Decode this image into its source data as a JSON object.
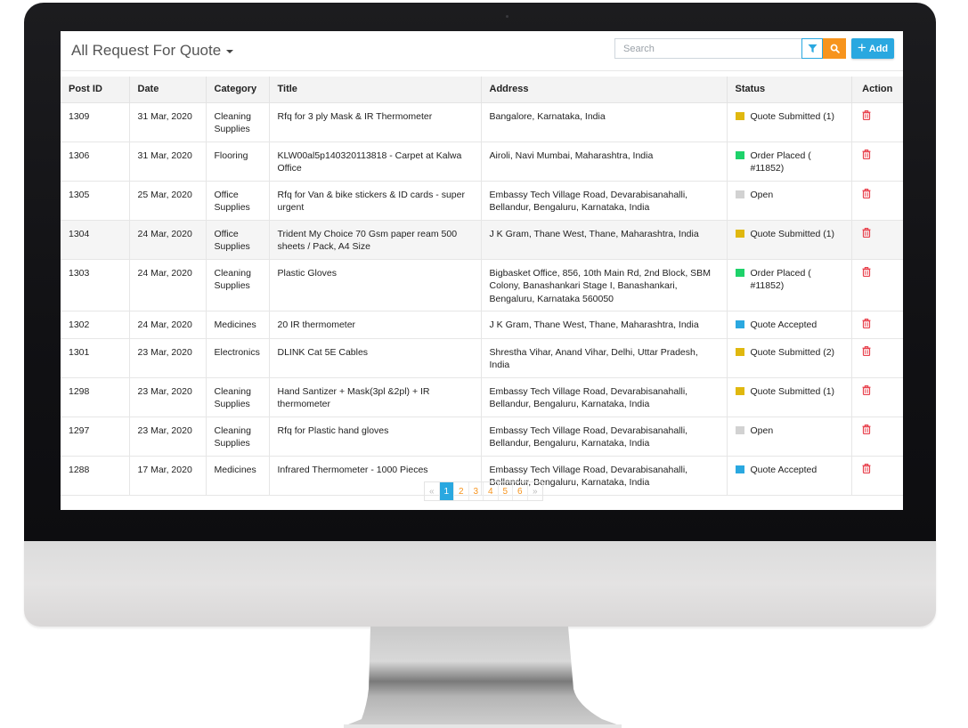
{
  "header": {
    "title": "All Request For Quote",
    "search_placeholder": "Search",
    "add_label": "Add"
  },
  "table": {
    "columns": [
      "Post ID",
      "Date",
      "Category",
      "Title",
      "Address",
      "Status",
      "Action"
    ],
    "rows": [
      {
        "id": "1309",
        "date": "31 Mar, 2020",
        "category": "Cleaning Supplies",
        "title": "Rfq for 3 ply Mask & IR Thermometer",
        "address": "Bangalore, Karnataka, India",
        "status": "Quote Submitted (1)",
        "status_color": "#e0b80f"
      },
      {
        "id": "1306",
        "date": "31 Mar, 2020",
        "category": "Flooring",
        "title": "KLW00al5p140320113818 - Carpet at Kalwa Office",
        "address": "Airoli, Navi Mumbai, Maharashtra, India",
        "status": "Order Placed ( #11852)",
        "status_color": "#1ed26a"
      },
      {
        "id": "1305",
        "date": "25 Mar, 2020",
        "category": "Office Supplies",
        "title": "Rfq for Van & bike stickers & ID cards - super urgent",
        "address": "Embassy Tech Village Road, Devarabisanahalli, Bellandur, Bengaluru, Karnataka, India",
        "status": "Open",
        "status_color": "#d2d2d2"
      },
      {
        "id": "1304",
        "date": "24 Mar, 2020",
        "category": "Office Supplies",
        "title": "Trident My Choice 70 Gsm paper ream 500 sheets / Pack, A4 Size",
        "address": "J K Gram, Thane West, Thane, Maharashtra, India",
        "status": "Quote Submitted (1)",
        "status_color": "#e0b80f"
      },
      {
        "id": "1303",
        "date": "24 Mar, 2020",
        "category": "Cleaning Supplies",
        "title": "Plastic Gloves",
        "address": "Bigbasket Office, 856, 10th Main Rd, 2nd Block, SBM Colony, Banashankari Stage I, Banashankari, Bengaluru, Karnataka 560050",
        "status": "Order Placed ( #11852)",
        "status_color": "#1ed26a"
      },
      {
        "id": "1302",
        "date": "24 Mar, 2020",
        "category": "Medicines",
        "title": "20 IR thermometer",
        "address": "J K Gram, Thane West, Thane, Maharashtra, India",
        "status": "Quote Accepted",
        "status_color": "#2aa8e0"
      },
      {
        "id": "1301",
        "date": "23 Mar, 2020",
        "category": "Electronics",
        "title": "DLINK Cat 5E Cables",
        "address": "Shrestha Vihar, Anand Vihar, Delhi, Uttar Pradesh, India",
        "status": "Quote Submitted (2)",
        "status_color": "#e0b80f"
      },
      {
        "id": "1298",
        "date": "23 Mar, 2020",
        "category": "Cleaning Supplies",
        "title": "Hand Santizer + Mask(3pl &2pl) + IR thermometer",
        "address": "Embassy Tech Village Road, Devarabisanahalli, Bellandur, Bengaluru, Karnataka, India",
        "status": "Quote Submitted (1)",
        "status_color": "#e0b80f"
      },
      {
        "id": "1297",
        "date": "23 Mar, 2020",
        "category": "Cleaning Supplies",
        "title": "Rfq for Plastic hand gloves",
        "address": "Embassy Tech Village Road, Devarabisanahalli, Bellandur, Bengaluru, Karnataka, India",
        "status": "Open",
        "status_color": "#d2d2d2"
      },
      {
        "id": "1288",
        "date": "17 Mar, 2020",
        "category": "Medicines",
        "title": "Infrared Thermometer - 1000 Pieces",
        "address": "Embassy Tech Village Road, Devarabisanahalli, Bellandur, Bengaluru, Karnataka, India",
        "status": "Quote Accepted",
        "status_color": "#2aa8e0"
      }
    ],
    "highlighted_row": 3
  },
  "pagination": {
    "prev": "«",
    "next": "»",
    "pages": [
      "1",
      "2",
      "3",
      "4",
      "5",
      "6"
    ],
    "current": "1"
  },
  "colors": {
    "accent_blue": "#2aa8e0",
    "accent_orange": "#f7941d",
    "delete_red": "#e8414d"
  },
  "icons": {
    "filter": "filter-icon",
    "search": "search-icon",
    "add": "plus-icon",
    "delete": "trash-icon",
    "title_dropdown": "caret-down-icon"
  }
}
